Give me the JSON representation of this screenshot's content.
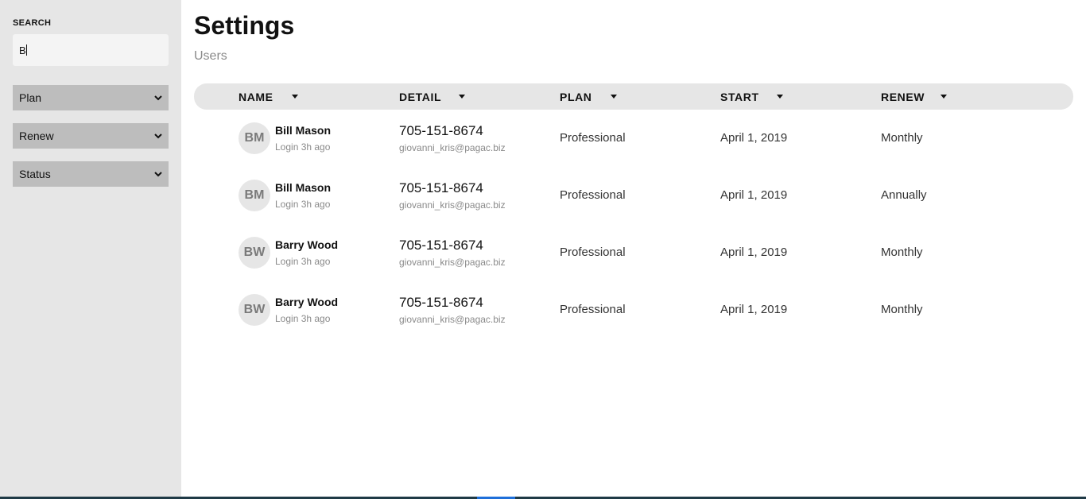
{
  "sidebar": {
    "search_label": "SEARCH",
    "search_value": "B",
    "filters": [
      {
        "label": "Plan",
        "icon": "chevron-down-icon"
      },
      {
        "label": "Renew",
        "icon": "chevron-down-icon"
      },
      {
        "label": "Status",
        "icon": "chevron-down-icon"
      }
    ]
  },
  "header": {
    "title": "Settings",
    "subtitle": "Users"
  },
  "table": {
    "columns": [
      "NAME",
      "DETAIL",
      "PLAN",
      "START",
      "RENEW"
    ],
    "rows": [
      {
        "initials": "BM",
        "name": "Bill Mason",
        "login": "Login 3h ago",
        "phone": "705-151-8674",
        "email": "giovanni_kris@pagac.biz",
        "plan": "Professional",
        "start": "April 1, 2019",
        "renew": "Monthly"
      },
      {
        "initials": "BM",
        "name": "Bill Mason",
        "login": "Login 3h ago",
        "phone": "705-151-8674",
        "email": "giovanni_kris@pagac.biz",
        "plan": "Professional",
        "start": "April 1, 2019",
        "renew": "Annually"
      },
      {
        "initials": "BW",
        "name": "Barry Wood",
        "login": "Login 3h ago",
        "phone": "705-151-8674",
        "email": "giovanni_kris@pagac.biz",
        "plan": "Professional",
        "start": "April 1, 2019",
        "renew": "Monthly"
      },
      {
        "initials": "BW",
        "name": "Barry Wood",
        "login": "Login 3h ago",
        "phone": "705-151-8674",
        "email": "giovanni_kris@pagac.biz",
        "plan": "Professional",
        "start": "April 1, 2019",
        "renew": "Monthly"
      }
    ]
  },
  "colors": {
    "sidebar_bg": "#e6e6e6",
    "filter_bg": "#bdbdbd",
    "muted_text": "#8a8a8a",
    "avatar_bg": "#e6e6e6"
  }
}
